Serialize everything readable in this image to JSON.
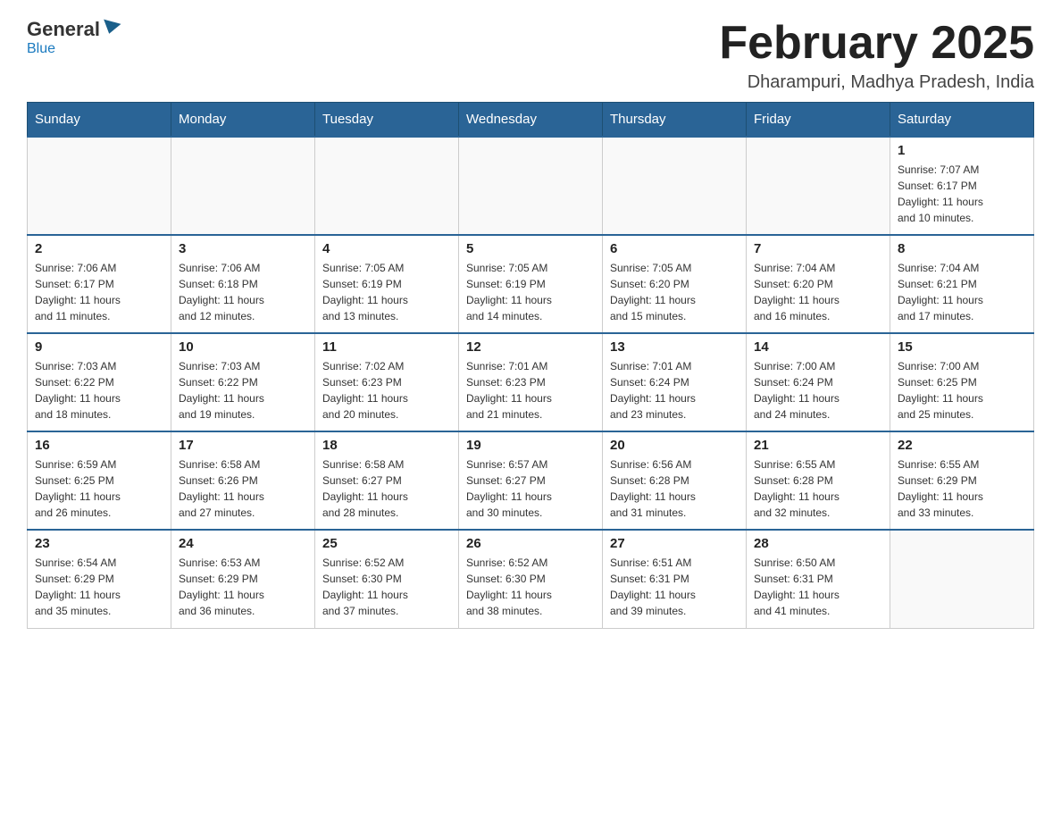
{
  "header": {
    "logo_general": "General",
    "logo_blue": "Blue",
    "month_title": "February 2025",
    "location": "Dharampuri, Madhya Pradesh, India"
  },
  "days_of_week": [
    "Sunday",
    "Monday",
    "Tuesday",
    "Wednesday",
    "Thursday",
    "Friday",
    "Saturday"
  ],
  "weeks": [
    [
      {
        "day": "",
        "info": ""
      },
      {
        "day": "",
        "info": ""
      },
      {
        "day": "",
        "info": ""
      },
      {
        "day": "",
        "info": ""
      },
      {
        "day": "",
        "info": ""
      },
      {
        "day": "",
        "info": ""
      },
      {
        "day": "1",
        "info": "Sunrise: 7:07 AM\nSunset: 6:17 PM\nDaylight: 11 hours\nand 10 minutes."
      }
    ],
    [
      {
        "day": "2",
        "info": "Sunrise: 7:06 AM\nSunset: 6:17 PM\nDaylight: 11 hours\nand 11 minutes."
      },
      {
        "day": "3",
        "info": "Sunrise: 7:06 AM\nSunset: 6:18 PM\nDaylight: 11 hours\nand 12 minutes."
      },
      {
        "day": "4",
        "info": "Sunrise: 7:05 AM\nSunset: 6:19 PM\nDaylight: 11 hours\nand 13 minutes."
      },
      {
        "day": "5",
        "info": "Sunrise: 7:05 AM\nSunset: 6:19 PM\nDaylight: 11 hours\nand 14 minutes."
      },
      {
        "day": "6",
        "info": "Sunrise: 7:05 AM\nSunset: 6:20 PM\nDaylight: 11 hours\nand 15 minutes."
      },
      {
        "day": "7",
        "info": "Sunrise: 7:04 AM\nSunset: 6:20 PM\nDaylight: 11 hours\nand 16 minutes."
      },
      {
        "day": "8",
        "info": "Sunrise: 7:04 AM\nSunset: 6:21 PM\nDaylight: 11 hours\nand 17 minutes."
      }
    ],
    [
      {
        "day": "9",
        "info": "Sunrise: 7:03 AM\nSunset: 6:22 PM\nDaylight: 11 hours\nand 18 minutes."
      },
      {
        "day": "10",
        "info": "Sunrise: 7:03 AM\nSunset: 6:22 PM\nDaylight: 11 hours\nand 19 minutes."
      },
      {
        "day": "11",
        "info": "Sunrise: 7:02 AM\nSunset: 6:23 PM\nDaylight: 11 hours\nand 20 minutes."
      },
      {
        "day": "12",
        "info": "Sunrise: 7:01 AM\nSunset: 6:23 PM\nDaylight: 11 hours\nand 21 minutes."
      },
      {
        "day": "13",
        "info": "Sunrise: 7:01 AM\nSunset: 6:24 PM\nDaylight: 11 hours\nand 23 minutes."
      },
      {
        "day": "14",
        "info": "Sunrise: 7:00 AM\nSunset: 6:24 PM\nDaylight: 11 hours\nand 24 minutes."
      },
      {
        "day": "15",
        "info": "Sunrise: 7:00 AM\nSunset: 6:25 PM\nDaylight: 11 hours\nand 25 minutes."
      }
    ],
    [
      {
        "day": "16",
        "info": "Sunrise: 6:59 AM\nSunset: 6:25 PM\nDaylight: 11 hours\nand 26 minutes."
      },
      {
        "day": "17",
        "info": "Sunrise: 6:58 AM\nSunset: 6:26 PM\nDaylight: 11 hours\nand 27 minutes."
      },
      {
        "day": "18",
        "info": "Sunrise: 6:58 AM\nSunset: 6:27 PM\nDaylight: 11 hours\nand 28 minutes."
      },
      {
        "day": "19",
        "info": "Sunrise: 6:57 AM\nSunset: 6:27 PM\nDaylight: 11 hours\nand 30 minutes."
      },
      {
        "day": "20",
        "info": "Sunrise: 6:56 AM\nSunset: 6:28 PM\nDaylight: 11 hours\nand 31 minutes."
      },
      {
        "day": "21",
        "info": "Sunrise: 6:55 AM\nSunset: 6:28 PM\nDaylight: 11 hours\nand 32 minutes."
      },
      {
        "day": "22",
        "info": "Sunrise: 6:55 AM\nSunset: 6:29 PM\nDaylight: 11 hours\nand 33 minutes."
      }
    ],
    [
      {
        "day": "23",
        "info": "Sunrise: 6:54 AM\nSunset: 6:29 PM\nDaylight: 11 hours\nand 35 minutes."
      },
      {
        "day": "24",
        "info": "Sunrise: 6:53 AM\nSunset: 6:29 PM\nDaylight: 11 hours\nand 36 minutes."
      },
      {
        "day": "25",
        "info": "Sunrise: 6:52 AM\nSunset: 6:30 PM\nDaylight: 11 hours\nand 37 minutes."
      },
      {
        "day": "26",
        "info": "Sunrise: 6:52 AM\nSunset: 6:30 PM\nDaylight: 11 hours\nand 38 minutes."
      },
      {
        "day": "27",
        "info": "Sunrise: 6:51 AM\nSunset: 6:31 PM\nDaylight: 11 hours\nand 39 minutes."
      },
      {
        "day": "28",
        "info": "Sunrise: 6:50 AM\nSunset: 6:31 PM\nDaylight: 11 hours\nand 41 minutes."
      },
      {
        "day": "",
        "info": ""
      }
    ]
  ]
}
